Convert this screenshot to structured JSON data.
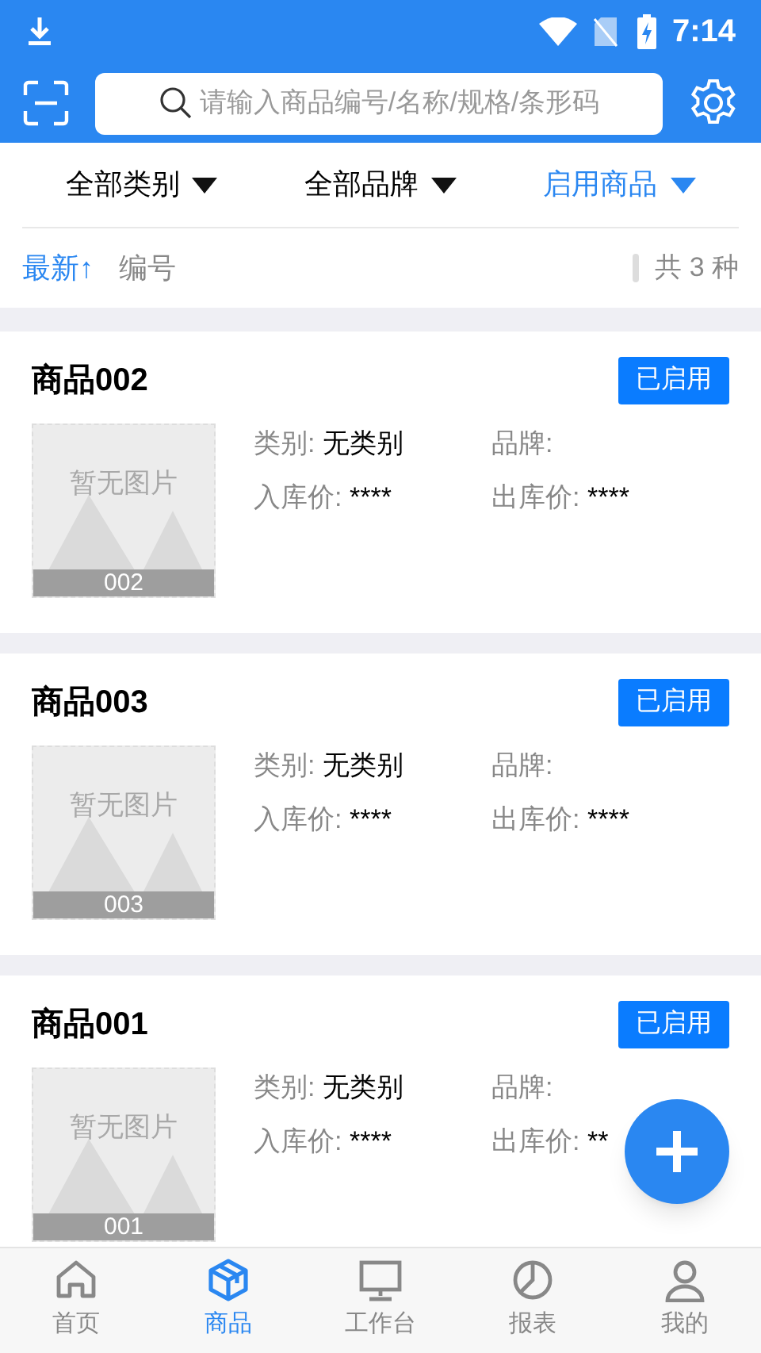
{
  "status_bar": {
    "time": "7:14"
  },
  "search": {
    "placeholder": "请输入商品编号/名称/规格/条形码"
  },
  "filters": [
    {
      "label": "全部类别",
      "selected": false
    },
    {
      "label": "全部品牌",
      "selected": false
    },
    {
      "label": "启用商品",
      "selected": true
    }
  ],
  "sort": [
    {
      "label": "最新↑",
      "selected": true
    },
    {
      "label": "编号",
      "selected": false
    }
  ],
  "total": "共 3 种",
  "products": [
    {
      "name": "商品002",
      "status": "已启用",
      "image_text": "暂无图片",
      "code": "002",
      "category_label": "类别:",
      "category": "无类别",
      "brand_label": "品牌:",
      "in_price_label": "入库价:",
      "in_price": "****",
      "out_price_label": "出库价:",
      "out_price": "****"
    },
    {
      "name": "商品003",
      "status": "已启用",
      "image_text": "暂无图片",
      "code": "003",
      "category_label": "类别:",
      "category": "无类别",
      "brand_label": "品牌:",
      "in_price_label": "入库价:",
      "in_price": "****",
      "out_price_label": "出库价:",
      "out_price": "****"
    },
    {
      "name": "商品001",
      "status": "已启用",
      "image_text": "暂无图片",
      "code": "001",
      "category_label": "类别:",
      "category": "无类别",
      "brand_label": "品牌:",
      "in_price_label": "入库价:",
      "in_price": "****",
      "out_price_label": "出库价:",
      "out_price": "**"
    }
  ],
  "nav": [
    {
      "label": "首页",
      "selected": false
    },
    {
      "label": "商品",
      "selected": true
    },
    {
      "label": "工作台",
      "selected": false
    },
    {
      "label": "报表",
      "selected": false
    },
    {
      "label": "我的",
      "selected": false
    }
  ]
}
